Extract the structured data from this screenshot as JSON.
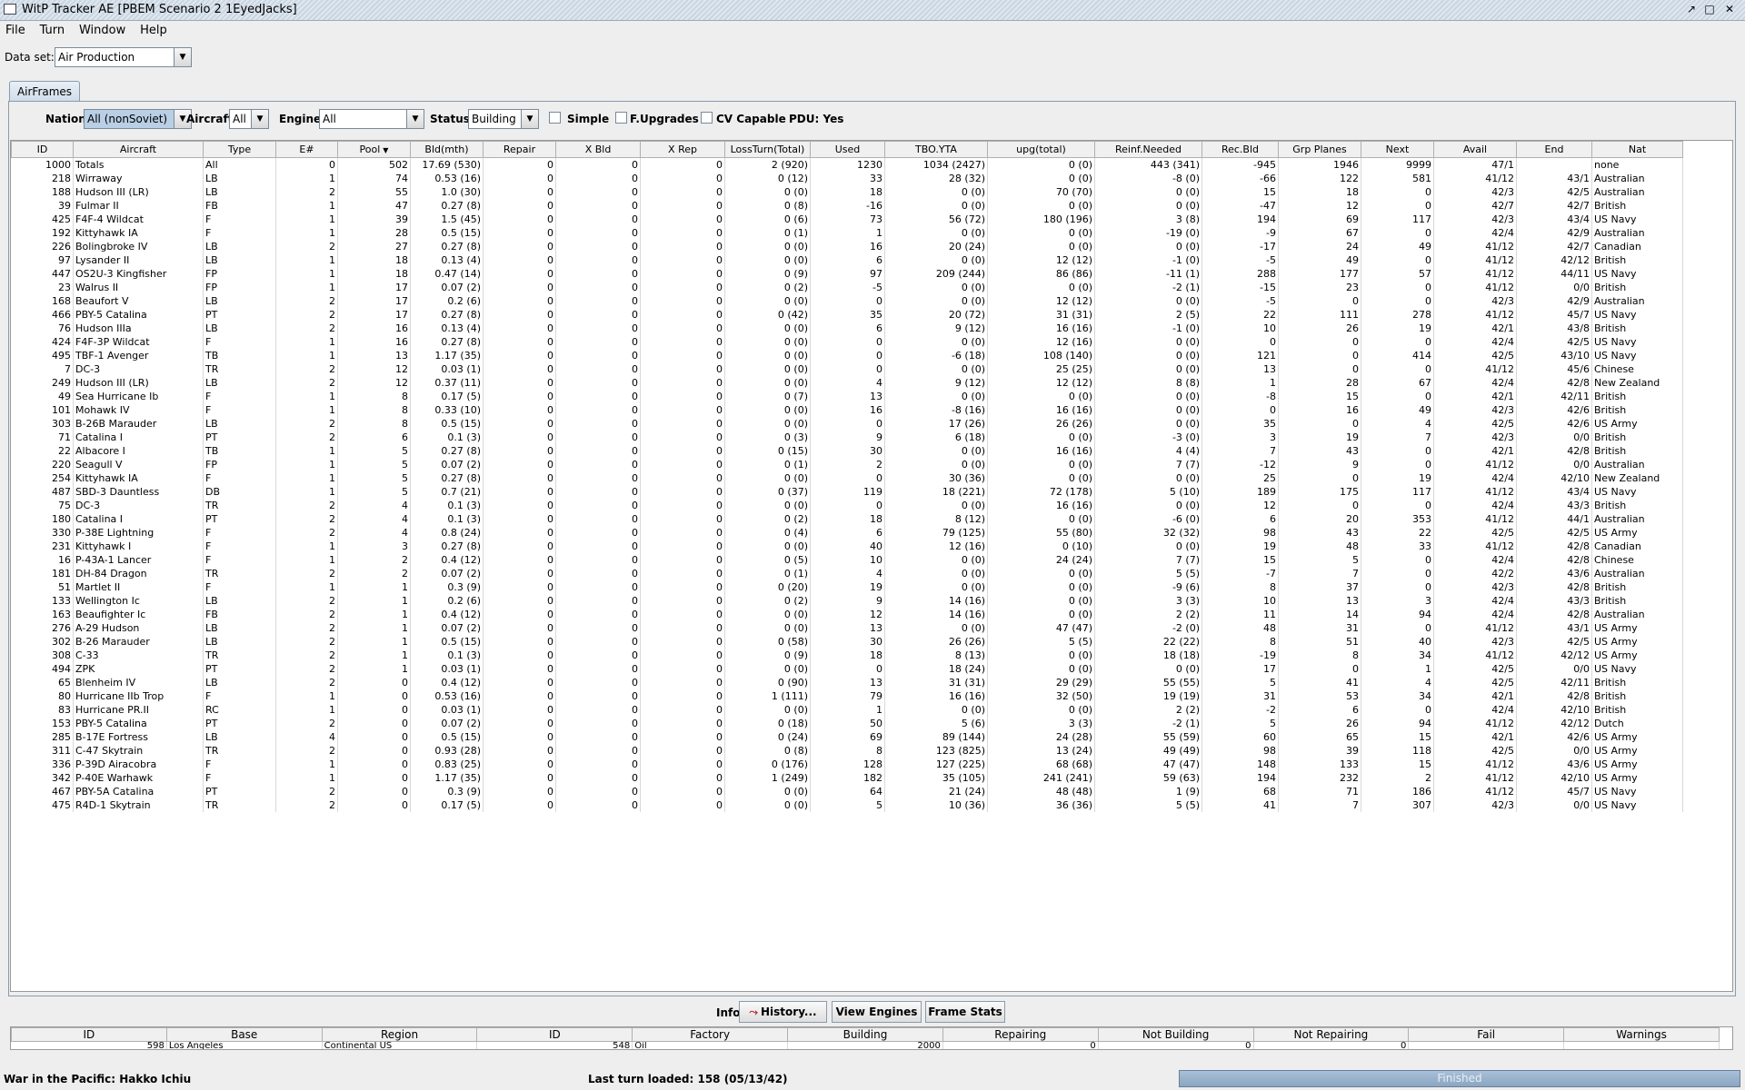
{
  "window": {
    "title": "WitP Tracker AE [PBEM Scenario 2 1EyedJacks]"
  },
  "menu": [
    "File",
    "Turn",
    "Window",
    "Help"
  ],
  "dataset": {
    "label": "Data set:",
    "value": "Air Production"
  },
  "tab": "AirFrames",
  "filters": {
    "nation_label": "Nation:",
    "nation_value": "All (nonSoviet)",
    "aircraft_label": "Aircraft:",
    "aircraft_value": "All",
    "engine_label": "Engine:",
    "engine_value": "All",
    "status_label": "Status:",
    "status_value": "Building",
    "simple": "Simple",
    "fupgrades": "F.Upgrades",
    "cv": "CV Capable",
    "pdu": "PDU: Yes"
  },
  "table": {
    "columns": [
      "ID",
      "Aircraft",
      "Type",
      "E#",
      "Pool",
      "Bld(mth)",
      "Repair",
      "X Bld",
      "X Rep",
      "LossTurn(Total)",
      "Used",
      "TBO.YTA",
      "upg(total)",
      "Reinf.Needed",
      "Rec.Bld",
      "Grp Planes",
      "Next",
      "Avail",
      "End",
      "Nat"
    ],
    "sorted_column": "Pool",
    "rows": [
      [
        "1000",
        "Totals",
        "All",
        "0",
        "502",
        "17.69 (530)",
        "0",
        "0",
        "0",
        "2 (920)",
        "1230",
        "1034 (2427)",
        "0 (0)",
        "443 (341)",
        "-945",
        "1946",
        "9999",
        "47/1",
        "",
        "none"
      ],
      [
        "218",
        "Wirraway",
        "LB",
        "1",
        "74",
        "0.53 (16)",
        "0",
        "0",
        "0",
        "0 (12)",
        "33",
        "28 (32)",
        "0 (0)",
        "-8 (0)",
        "-66",
        "122",
        "581",
        "41/12",
        "43/1",
        "Australian"
      ],
      [
        "188",
        "Hudson III (LR)",
        "LB",
        "2",
        "55",
        "1.0 (30)",
        "0",
        "0",
        "0",
        "0 (0)",
        "18",
        "0 (0)",
        "70 (70)",
        "0 (0)",
        "15",
        "18",
        "0",
        "42/3",
        "42/5",
        "Australian"
      ],
      [
        "39",
        "Fulmar II",
        "FB",
        "1",
        "47",
        "0.27 (8)",
        "0",
        "0",
        "0",
        "0 (8)",
        "-16",
        "0 (0)",
        "0 (0)",
        "0 (0)",
        "-47",
        "12",
        "0",
        "42/7",
        "42/7",
        "British"
      ],
      [
        "425",
        "F4F-4 Wildcat",
        "F",
        "1",
        "39",
        "1.5 (45)",
        "0",
        "0",
        "0",
        "0 (6)",
        "73",
        "56 (72)",
        "180 (196)",
        "3 (8)",
        "194",
        "69",
        "117",
        "42/3",
        "43/4",
        "US Navy"
      ],
      [
        "192",
        "Kittyhawk IA",
        "F",
        "1",
        "28",
        "0.5 (15)",
        "0",
        "0",
        "0",
        "0 (1)",
        "1",
        "0 (0)",
        "0 (0)",
        "-19 (0)",
        "-9",
        "67",
        "0",
        "42/4",
        "42/9",
        "Australian"
      ],
      [
        "226",
        "Bolingbroke IV",
        "LB",
        "2",
        "27",
        "0.27 (8)",
        "0",
        "0",
        "0",
        "0 (0)",
        "16",
        "20 (24)",
        "0 (0)",
        "0 (0)",
        "-17",
        "24",
        "49",
        "41/12",
        "42/7",
        "Canadian"
      ],
      [
        "97",
        "Lysander II",
        "LB",
        "1",
        "18",
        "0.13 (4)",
        "0",
        "0",
        "0",
        "0 (0)",
        "6",
        "0 (0)",
        "12 (12)",
        "-1 (0)",
        "-5",
        "49",
        "0",
        "41/12",
        "42/12",
        "British"
      ],
      [
        "447",
        "OS2U-3 Kingfisher",
        "FP",
        "1",
        "18",
        "0.47 (14)",
        "0",
        "0",
        "0",
        "0 (9)",
        "97",
        "209 (244)",
        "86 (86)",
        "-11 (1)",
        "288",
        "177",
        "57",
        "41/12",
        "44/11",
        "US Navy"
      ],
      [
        "23",
        "Walrus II",
        "FP",
        "1",
        "17",
        "0.07 (2)",
        "0",
        "0",
        "0",
        "0 (2)",
        "-5",
        "0 (0)",
        "0 (0)",
        "-2 (1)",
        "-15",
        "23",
        "0",
        "41/12",
        "0/0",
        "British"
      ],
      [
        "168",
        "Beaufort V",
        "LB",
        "2",
        "17",
        "0.2 (6)",
        "0",
        "0",
        "0",
        "0 (0)",
        "0",
        "0 (0)",
        "12 (12)",
        "0 (0)",
        "-5",
        "0",
        "0",
        "42/3",
        "42/9",
        "Australian"
      ],
      [
        "466",
        "PBY-5 Catalina",
        "PT",
        "2",
        "17",
        "0.27 (8)",
        "0",
        "0",
        "0",
        "0 (42)",
        "35",
        "20 (72)",
        "31 (31)",
        "2 (5)",
        "22",
        "111",
        "278",
        "41/12",
        "45/7",
        "US Navy"
      ],
      [
        "76",
        "Hudson IIIa",
        "LB",
        "2",
        "16",
        "0.13 (4)",
        "0",
        "0",
        "0",
        "0 (0)",
        "6",
        "9 (12)",
        "16 (16)",
        "-1 (0)",
        "10",
        "26",
        "19",
        "42/1",
        "43/8",
        "British"
      ],
      [
        "424",
        "F4F-3P Wildcat",
        "F",
        "1",
        "16",
        "0.27 (8)",
        "0",
        "0",
        "0",
        "0 (0)",
        "0",
        "0 (0)",
        "12 (16)",
        "0 (0)",
        "0",
        "0",
        "0",
        "42/4",
        "42/5",
        "US Navy"
      ],
      [
        "495",
        "TBF-1 Avenger",
        "TB",
        "1",
        "13",
        "1.17 (35)",
        "0",
        "0",
        "0",
        "0 (0)",
        "0",
        "-6 (18)",
        "108 (140)",
        "0 (0)",
        "121",
        "0",
        "414",
        "42/5",
        "43/10",
        "US Navy"
      ],
      [
        "7",
        "DC-3",
        "TR",
        "2",
        "12",
        "0.03 (1)",
        "0",
        "0",
        "0",
        "0 (0)",
        "0",
        "0 (0)",
        "25 (25)",
        "0 (0)",
        "13",
        "0",
        "0",
        "41/12",
        "45/6",
        "Chinese"
      ],
      [
        "249",
        "Hudson III (LR)",
        "LB",
        "2",
        "12",
        "0.37 (11)",
        "0",
        "0",
        "0",
        "0 (0)",
        "4",
        "9 (12)",
        "12 (12)",
        "8 (8)",
        "1",
        "28",
        "67",
        "42/4",
        "42/8",
        "New Zealand"
      ],
      [
        "49",
        "Sea Hurricane Ib",
        "F",
        "1",
        "8",
        "0.17 (5)",
        "0",
        "0",
        "0",
        "0 (7)",
        "13",
        "0 (0)",
        "0 (0)",
        "0 (0)",
        "-8",
        "15",
        "0",
        "42/1",
        "42/11",
        "British"
      ],
      [
        "101",
        "Mohawk IV",
        "F",
        "1",
        "8",
        "0.33 (10)",
        "0",
        "0",
        "0",
        "0 (0)",
        "16",
        "-8 (16)",
        "16 (16)",
        "0 (0)",
        "0",
        "16",
        "49",
        "42/3",
        "42/6",
        "British"
      ],
      [
        "303",
        "B-26B Marauder",
        "LB",
        "2",
        "8",
        "0.5 (15)",
        "0",
        "0",
        "0",
        "0 (0)",
        "0",
        "17 (26)",
        "26 (26)",
        "0 (0)",
        "35",
        "0",
        "4",
        "42/5",
        "42/6",
        "US Army"
      ],
      [
        "71",
        "Catalina I",
        "PT",
        "2",
        "6",
        "0.1 (3)",
        "0",
        "0",
        "0",
        "0 (3)",
        "9",
        "6 (18)",
        "0 (0)",
        "-3 (0)",
        "3",
        "19",
        "7",
        "42/3",
        "0/0",
        "British"
      ],
      [
        "22",
        "Albacore I",
        "TB",
        "1",
        "5",
        "0.27 (8)",
        "0",
        "0",
        "0",
        "0 (15)",
        "30",
        "0 (0)",
        "16 (16)",
        "4 (4)",
        "7",
        "43",
        "0",
        "42/1",
        "42/8",
        "British"
      ],
      [
        "220",
        "Seagull V",
        "FP",
        "1",
        "5",
        "0.07 (2)",
        "0",
        "0",
        "0",
        "0 (1)",
        "2",
        "0 (0)",
        "0 (0)",
        "7 (7)",
        "-12",
        "9",
        "0",
        "41/12",
        "0/0",
        "Australian"
      ],
      [
        "254",
        "Kittyhawk IA",
        "F",
        "1",
        "5",
        "0.27 (8)",
        "0",
        "0",
        "0",
        "0 (0)",
        "0",
        "30 (36)",
        "0 (0)",
        "0 (0)",
        "25",
        "0",
        "19",
        "42/4",
        "42/10",
        "New Zealand"
      ],
      [
        "487",
        "SBD-3 Dauntless",
        "DB",
        "1",
        "5",
        "0.7 (21)",
        "0",
        "0",
        "0",
        "0 (37)",
        "119",
        "18 (221)",
        "72 (178)",
        "5 (10)",
        "189",
        "175",
        "117",
        "41/12",
        "43/4",
        "US Navy"
      ],
      [
        "75",
        "DC-3",
        "TR",
        "2",
        "4",
        "0.1 (3)",
        "0",
        "0",
        "0",
        "0 (0)",
        "0",
        "0 (0)",
        "16 (16)",
        "0 (0)",
        "12",
        "0",
        "0",
        "42/4",
        "43/3",
        "British"
      ],
      [
        "180",
        "Catalina I",
        "PT",
        "2",
        "4",
        "0.1 (3)",
        "0",
        "0",
        "0",
        "0 (2)",
        "18",
        "8 (12)",
        "0 (0)",
        "-6 (0)",
        "6",
        "20",
        "353",
        "41/12",
        "44/1",
        "Australian"
      ],
      [
        "330",
        "P-38E Lightning",
        "F",
        "2",
        "4",
        "0.8 (24)",
        "0",
        "0",
        "0",
        "0 (4)",
        "6",
        "79 (125)",
        "55 (80)",
        "32 (32)",
        "98",
        "43",
        "22",
        "42/5",
        "42/5",
        "US Army"
      ],
      [
        "231",
        "Kittyhawk I",
        "F",
        "1",
        "3",
        "0.27 (8)",
        "0",
        "0",
        "0",
        "0 (0)",
        "40",
        "12 (16)",
        "0 (10)",
        "0 (0)",
        "19",
        "48",
        "33",
        "41/12",
        "42/8",
        "Canadian"
      ],
      [
        "16",
        "P-43A-1 Lancer",
        "F",
        "1",
        "2",
        "0.4 (12)",
        "0",
        "0",
        "0",
        "0 (5)",
        "10",
        "0 (0)",
        "24 (24)",
        "7 (7)",
        "15",
        "5",
        "0",
        "42/4",
        "42/8",
        "Chinese"
      ],
      [
        "181",
        "DH-84 Dragon",
        "TR",
        "2",
        "2",
        "0.07 (2)",
        "0",
        "0",
        "0",
        "0 (1)",
        "4",
        "0 (0)",
        "0 (0)",
        "5 (5)",
        "-7",
        "7",
        "0",
        "42/2",
        "43/6",
        "Australian"
      ],
      [
        "51",
        "Martlet II",
        "F",
        "1",
        "1",
        "0.3 (9)",
        "0",
        "0",
        "0",
        "0 (20)",
        "19",
        "0 (0)",
        "0 (0)",
        "-9 (6)",
        "8",
        "37",
        "0",
        "42/3",
        "42/8",
        "British"
      ],
      [
        "133",
        "Wellington Ic",
        "LB",
        "2",
        "1",
        "0.2 (6)",
        "0",
        "0",
        "0",
        "0 (2)",
        "9",
        "14 (16)",
        "0 (0)",
        "3 (3)",
        "10",
        "13",
        "3",
        "42/4",
        "43/3",
        "British"
      ],
      [
        "163",
        "Beaufighter Ic",
        "FB",
        "2",
        "1",
        "0.4 (12)",
        "0",
        "0",
        "0",
        "0 (0)",
        "12",
        "14 (16)",
        "0 (0)",
        "2 (2)",
        "11",
        "14",
        "94",
        "42/4",
        "42/8",
        "Australian"
      ],
      [
        "276",
        "A-29 Hudson",
        "LB",
        "2",
        "1",
        "0.07 (2)",
        "0",
        "0",
        "0",
        "0 (0)",
        "13",
        "0 (0)",
        "47 (47)",
        "-2 (0)",
        "48",
        "31",
        "0",
        "41/12",
        "43/1",
        "US Army"
      ],
      [
        "302",
        "B-26 Marauder",
        "LB",
        "2",
        "1",
        "0.5 (15)",
        "0",
        "0",
        "0",
        "0 (58)",
        "30",
        "26 (26)",
        "5 (5)",
        "22 (22)",
        "8",
        "51",
        "40",
        "42/3",
        "42/5",
        "US Army"
      ],
      [
        "308",
        "C-33",
        "TR",
        "2",
        "1",
        "0.1 (3)",
        "0",
        "0",
        "0",
        "0 (9)",
        "18",
        "8 (13)",
        "0 (0)",
        "18 (18)",
        "-19",
        "8",
        "34",
        "41/12",
        "42/12",
        "US Army"
      ],
      [
        "494",
        "ZPK",
        "PT",
        "2",
        "1",
        "0.03 (1)",
        "0",
        "0",
        "0",
        "0 (0)",
        "0",
        "18 (24)",
        "0 (0)",
        "0 (0)",
        "17",
        "0",
        "1",
        "42/5",
        "0/0",
        "US Navy"
      ],
      [
        "65",
        "Blenheim IV",
        "LB",
        "2",
        "0",
        "0.4 (12)",
        "0",
        "0",
        "0",
        "0 (90)",
        "13",
        "31 (31)",
        "29 (29)",
        "55 (55)",
        "5",
        "41",
        "4",
        "42/5",
        "42/11",
        "British"
      ],
      [
        "80",
        "Hurricane IIb Trop",
        "F",
        "1",
        "0",
        "0.53 (16)",
        "0",
        "0",
        "0",
        "1 (111)",
        "79",
        "16 (16)",
        "32 (50)",
        "19 (19)",
        "31",
        "53",
        "34",
        "42/1",
        "42/8",
        "British"
      ],
      [
        "83",
        "Hurricane PR.II",
        "RC",
        "1",
        "0",
        "0.03 (1)",
        "0",
        "0",
        "0",
        "0 (0)",
        "1",
        "0 (0)",
        "0 (0)",
        "2 (2)",
        "-2",
        "6",
        "0",
        "42/4",
        "42/10",
        "British"
      ],
      [
        "153",
        "PBY-5 Catalina",
        "PT",
        "2",
        "0",
        "0.07 (2)",
        "0",
        "0",
        "0",
        "0 (18)",
        "50",
        "5 (6)",
        "3 (3)",
        "-2 (1)",
        "5",
        "26",
        "94",
        "41/12",
        "42/12",
        "Dutch"
      ],
      [
        "285",
        "B-17E Fortress",
        "LB",
        "4",
        "0",
        "0.5 (15)",
        "0",
        "0",
        "0",
        "0 (24)",
        "69",
        "89 (144)",
        "24 (28)",
        "55 (59)",
        "60",
        "65",
        "15",
        "42/1",
        "42/6",
        "US Army"
      ],
      [
        "311",
        "C-47 Skytrain",
        "TR",
        "2",
        "0",
        "0.93 (28)",
        "0",
        "0",
        "0",
        "0 (8)",
        "8",
        "123 (825)",
        "13 (24)",
        "49 (49)",
        "98",
        "39",
        "118",
        "42/5",
        "0/0",
        "US Army"
      ],
      [
        "336",
        "P-39D Airacobra",
        "F",
        "1",
        "0",
        "0.83 (25)",
        "0",
        "0",
        "0",
        "0 (176)",
        "128",
        "127 (225)",
        "68 (68)",
        "47 (47)",
        "148",
        "133",
        "15",
        "41/12",
        "43/6",
        "US Army"
      ],
      [
        "342",
        "P-40E Warhawk",
        "F",
        "1",
        "0",
        "1.17 (35)",
        "0",
        "0",
        "0",
        "1 (249)",
        "182",
        "35 (105)",
        "241 (241)",
        "59 (63)",
        "194",
        "232",
        "2",
        "41/12",
        "42/10",
        "US Army"
      ],
      [
        "467",
        "PBY-5A Catalina",
        "PT",
        "2",
        "0",
        "0.3 (9)",
        "0",
        "0",
        "0",
        "0 (0)",
        "64",
        "21 (24)",
        "48 (48)",
        "1 (9)",
        "68",
        "71",
        "186",
        "41/12",
        "45/7",
        "US Navy"
      ],
      [
        "475",
        "R4D-1 Skytrain",
        "TR",
        "2",
        "0",
        "0.17 (5)",
        "0",
        "0",
        "0",
        "0 (0)",
        "5",
        "10 (36)",
        "36 (36)",
        "5 (5)",
        "41",
        "7",
        "307",
        "42/3",
        "0/0",
        "US Navy"
      ]
    ]
  },
  "info": {
    "label": "Info:",
    "history": "History...",
    "view_engines": "View Engines",
    "frame_stats": "Frame Stats"
  },
  "bottom_table": {
    "columns": [
      "ID",
      "Base",
      "Region",
      "ID",
      "Factory",
      "Building",
      "Repairing",
      "Not Building",
      "Not Repairing",
      "Fail",
      "Warnings"
    ],
    "partial_row": [
      "598",
      "Los Angeles",
      "Continental US",
      "548",
      "Oil",
      "2000",
      "0",
      "0",
      "0",
      "",
      ""
    ]
  },
  "status": {
    "left": "War in the Pacific: Hakko Ichiu",
    "mid": "Last turn loaded: 158 (05/13/42)",
    "progress": "Finished"
  }
}
